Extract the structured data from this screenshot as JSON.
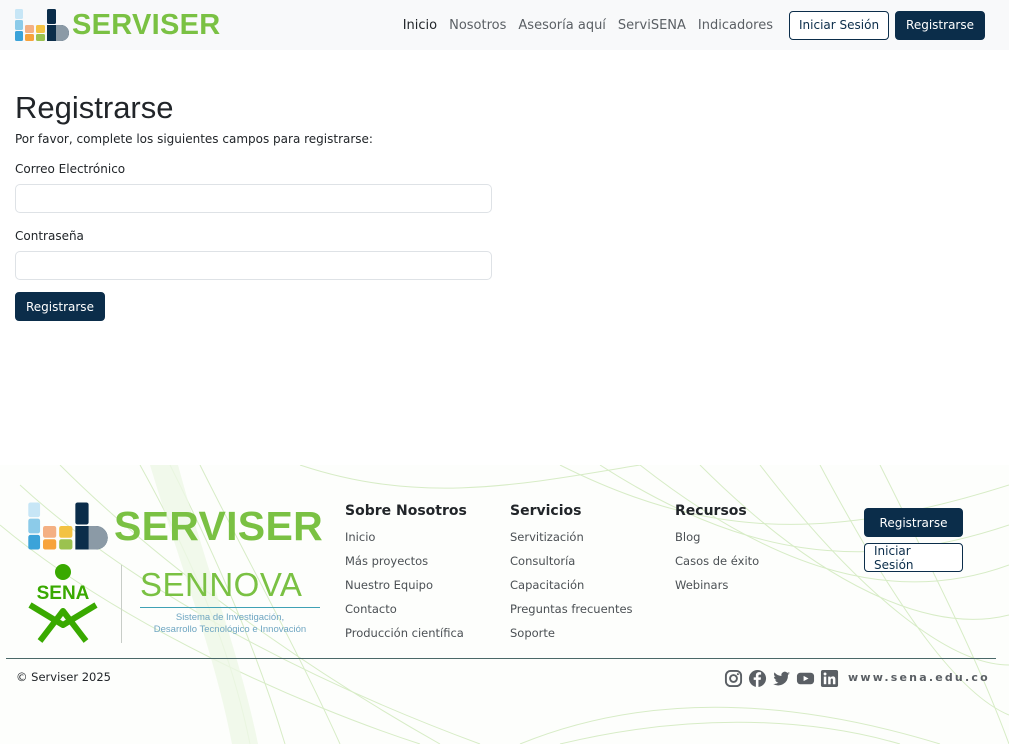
{
  "brand": {
    "name": "SERVISER",
    "color": "#7ac143"
  },
  "nav": {
    "links": [
      "Inicio",
      "Nosotros",
      "Asesoría aquí",
      "ServiSENA",
      "Indicadores"
    ],
    "active": "Inicio",
    "login_label": "Iniciar Sesión",
    "register_label": "Registrarse"
  },
  "form": {
    "title": "Registrarse",
    "subtitle": "Por favor, complete los siguientes campos para registrarse:",
    "email_label": "Correo Electrónico",
    "email_value": "",
    "password_label": "Contraseña",
    "password_value": "",
    "submit_label": "Registrarse"
  },
  "footer": {
    "brand": "SERVISER",
    "sena_text": "SENA",
    "sennova": {
      "word": "SENNOVA",
      "sub_line1": "Sistema de Investigación,",
      "sub_line2": "Desarrollo Tecnológico e Innovación"
    },
    "columns": [
      {
        "title": "Sobre Nosotros",
        "links": [
          "Inicio",
          "Más proyectos",
          "Nuestro Equipo",
          "Contacto",
          "Producción científica"
        ]
      },
      {
        "title": "Servicios",
        "links": [
          "Servitización",
          "Consultoría",
          "Capacitación",
          "Preguntas frecuentes",
          "Soporte"
        ]
      },
      {
        "title": "Recursos",
        "links": [
          "Blog",
          "Casos de éxito",
          "Webinars"
        ]
      }
    ],
    "register_label": "Registrarse",
    "login_label": "Iniciar Sesión",
    "copyright": "© Serviser 2025",
    "socials": [
      "instagram-icon",
      "facebook-icon",
      "twitter-icon",
      "youtube-icon",
      "linkedin-icon"
    ],
    "url": "www.sena.edu.co"
  },
  "colors": {
    "primary": "#0b2d4a",
    "accent_green": "#7ac143",
    "sena_green": "#39a900"
  }
}
